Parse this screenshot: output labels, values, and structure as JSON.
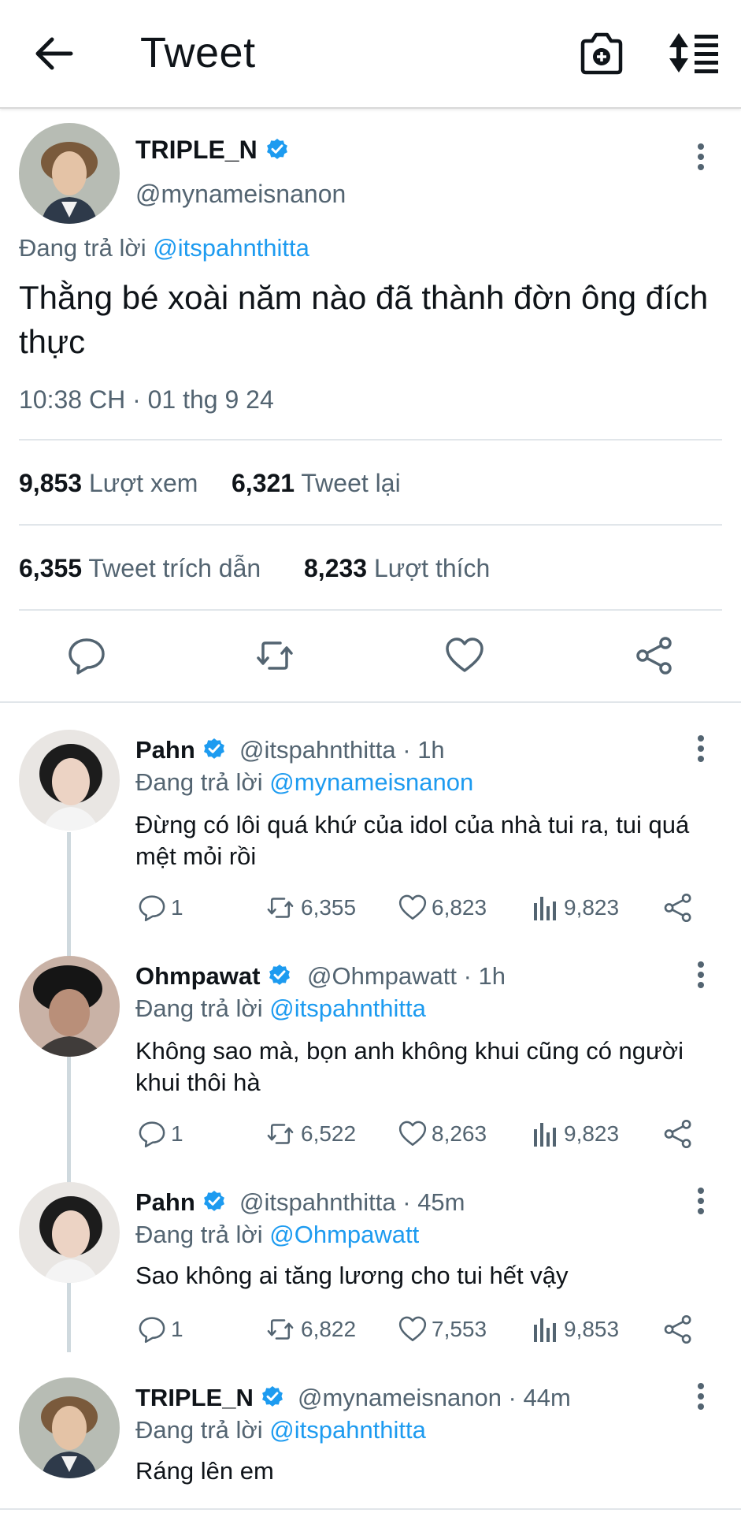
{
  "header": {
    "title": "Tweet"
  },
  "main": {
    "name": "TRIPLE_N",
    "handle": "@mynameisnanon",
    "replying_prefix": "Đang trả lời",
    "replying_to": "@itspahnthitta",
    "text": "Thằng bé xoài năm nào đã thành đờn ông đích thực",
    "timestamp": "10:38 CH · 01 thg 9 24",
    "stats": {
      "views_count": "9,853",
      "views_label": "Lượt xem",
      "retweets_count": "6,321",
      "retweets_label": "Tweet lại",
      "quotes_count": "6,355",
      "quotes_label": "Tweet trích dẫn",
      "likes_count": "8,233",
      "likes_label": "Lượt thích"
    }
  },
  "replies": [
    {
      "name": "Pahn",
      "meta": "@itspahnthitta · 1h",
      "replying_prefix": "Đang trả lời",
      "replying_to": "@mynameisnanon",
      "text": "Đừng có lôi quá khứ của idol của nhà tui ra, tui quá mệt mỏi rồi",
      "replies": "1",
      "retweets": "6,355",
      "likes": "6,823",
      "views": "9,823"
    },
    {
      "name": "Ohmpawat",
      "meta": "@Ohmpawatt · 1h",
      "replying_prefix": "Đang trả lời",
      "replying_to": "@itspahnthitta",
      "text": "Không sao mà, bọn anh không khui cũng có người khui thôi hà",
      "replies": "1",
      "retweets": "6,522",
      "likes": "8,263",
      "views": "9,823"
    },
    {
      "name": "Pahn",
      "meta": "@itspahnthitta · 45m",
      "replying_prefix": "Đang trả lời",
      "replying_to": "@Ohmpawatt",
      "text": "Sao không ai tăng lương cho tui hết vậy",
      "replies": "1",
      "retweets": "6,822",
      "likes": "7,553",
      "views": "9,853"
    },
    {
      "name": "TRIPLE_N",
      "meta": "@mynameisnanon · 44m",
      "replying_prefix": "Đang trả lời",
      "replying_to": "@itspahnthitta",
      "text": "Ráng lên em"
    }
  ],
  "colors": {
    "accent": "#1d9bf0",
    "secondary_text": "#536471",
    "divider": "#e1e6ea"
  }
}
